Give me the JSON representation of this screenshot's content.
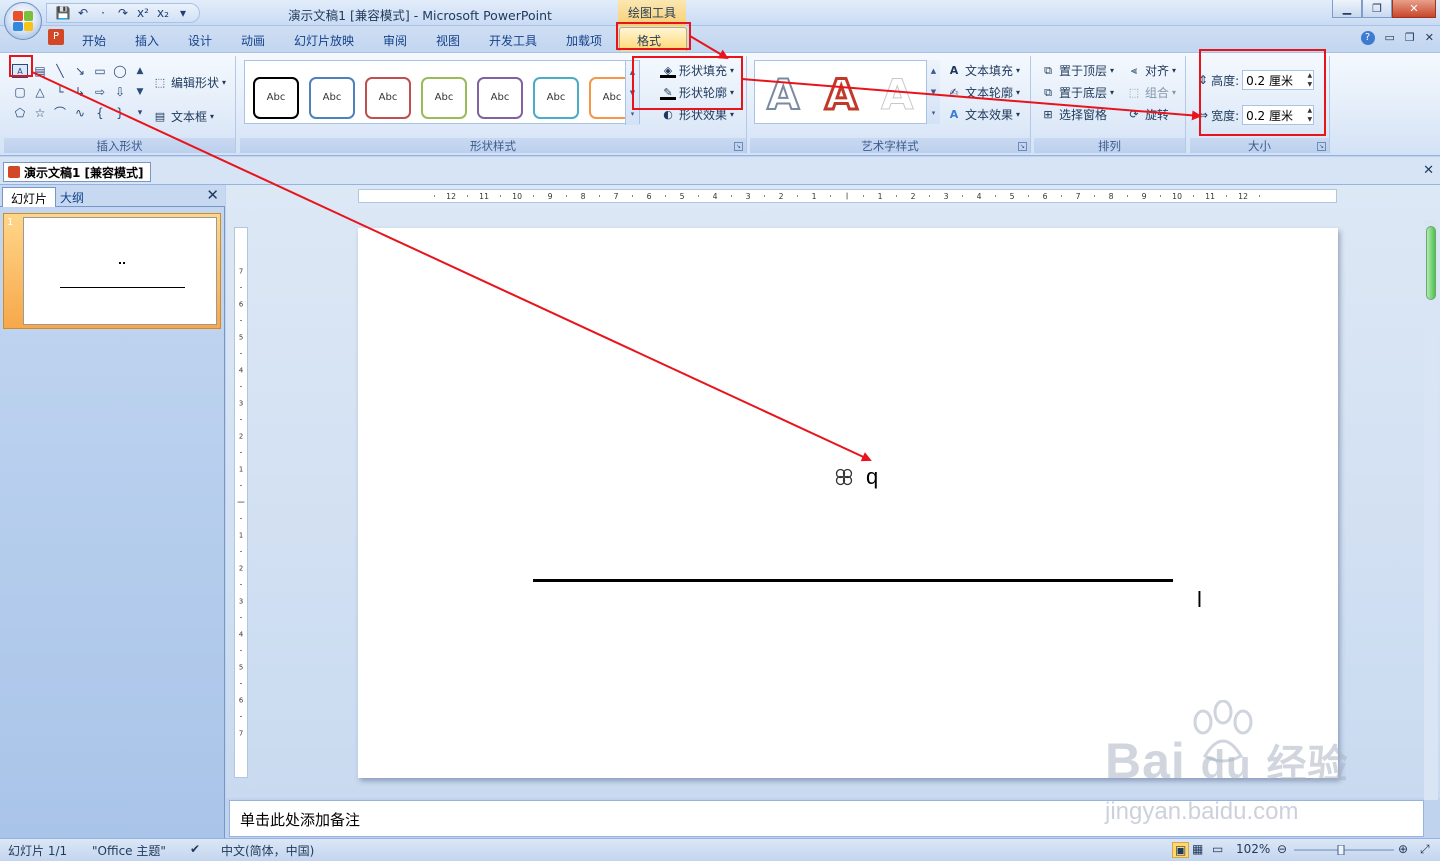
{
  "window": {
    "title": "演示文稿1 [兼容模式] - Microsoft PowerPoint",
    "context_tab_group": "绘图工具"
  },
  "qat": [
    "💾",
    "↶",
    "·",
    "↷",
    "x²",
    "x₂",
    "▾"
  ],
  "tabs": [
    {
      "label": "开始"
    },
    {
      "label": "插入"
    },
    {
      "label": "设计"
    },
    {
      "label": "动画"
    },
    {
      "label": "幻灯片放映"
    },
    {
      "label": "审阅"
    },
    {
      "label": "视图"
    },
    {
      "label": "开发工具"
    },
    {
      "label": "加载项"
    },
    {
      "label": "格式"
    }
  ],
  "ribbon": {
    "insert_shapes": {
      "label": "插入形状",
      "edit_shape": "编辑形状",
      "textbox": "文本框"
    },
    "shape_styles": {
      "label": "形状样式",
      "sample": "Abc",
      "swatches": [
        "#000000",
        "#4f81bd",
        "#c0504d",
        "#9bbb59",
        "#8064a2",
        "#4bacc6",
        "#f79646"
      ],
      "fill": "形状填充",
      "outline": "形状轮廓",
      "effects": "形状效果"
    },
    "wordart": {
      "label": "艺术字样式",
      "text_fill": "文本填充",
      "text_outline": "文本轮廓",
      "text_effects": "文本效果"
    },
    "arrange": {
      "label": "排列",
      "bring_front": "置于顶层",
      "send_back": "置于底层",
      "selection_pane": "选择窗格",
      "align": "对齐",
      "group": "组合",
      "rotate": "旋转"
    },
    "size": {
      "label": "大小",
      "height_label": "高度:",
      "height_value": "0.2 厘米",
      "width_label": "宽度:",
      "width_value": "0.2 厘米"
    }
  },
  "doc_tab": "演示文稿1 [兼容模式]",
  "left_pane": {
    "tab_slides": "幻灯片",
    "tab_outline": "大纲",
    "slide_number": "1"
  },
  "slide": {
    "text_q": "q",
    "text_l": "l"
  },
  "notes_placeholder": "单击此处添加备注",
  "status": {
    "slide_count": "幻灯片 1/1",
    "theme": "\"Office 主题\"",
    "language": "中文(简体，中国)",
    "zoom": "102%"
  },
  "watermark": {
    "brand": "Bai",
    "brand_cn": "经验",
    "url": "jingyan.baidu.com"
  }
}
